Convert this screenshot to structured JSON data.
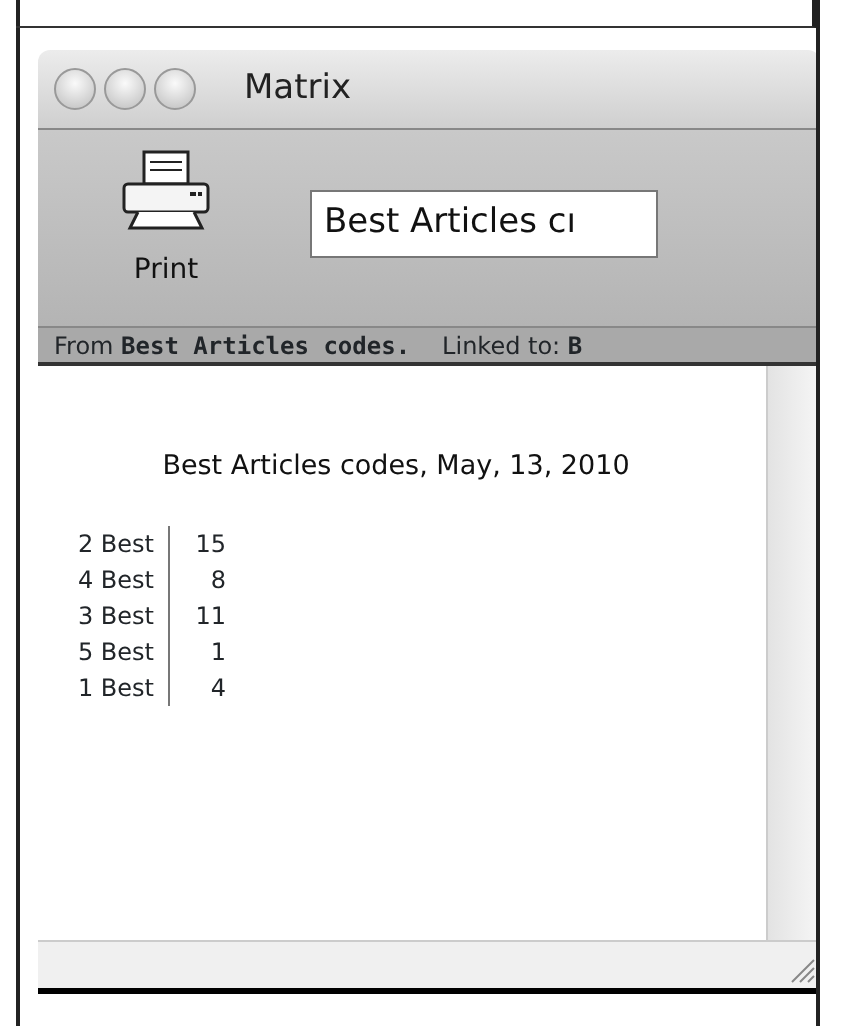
{
  "window": {
    "title": "Matrix"
  },
  "toolbar": {
    "print_label": "Print",
    "field_value": "Best Articles cı"
  },
  "info_bar": {
    "source": "From **Best Articles codes.**",
    "link": "Linked to: **B**"
  },
  "document": {
    "title": "Best Articles codes, May, 13, 2010",
    "rows": [
      {
        "label": "2 Best",
        "value": "15"
      },
      {
        "label": "4 Best",
        "value": "8"
      },
      {
        "label": "3 Best",
        "value": "11"
      },
      {
        "label": "5 Best",
        "value": "1"
      },
      {
        "label": "1 Best",
        "value": "4"
      }
    ]
  }
}
